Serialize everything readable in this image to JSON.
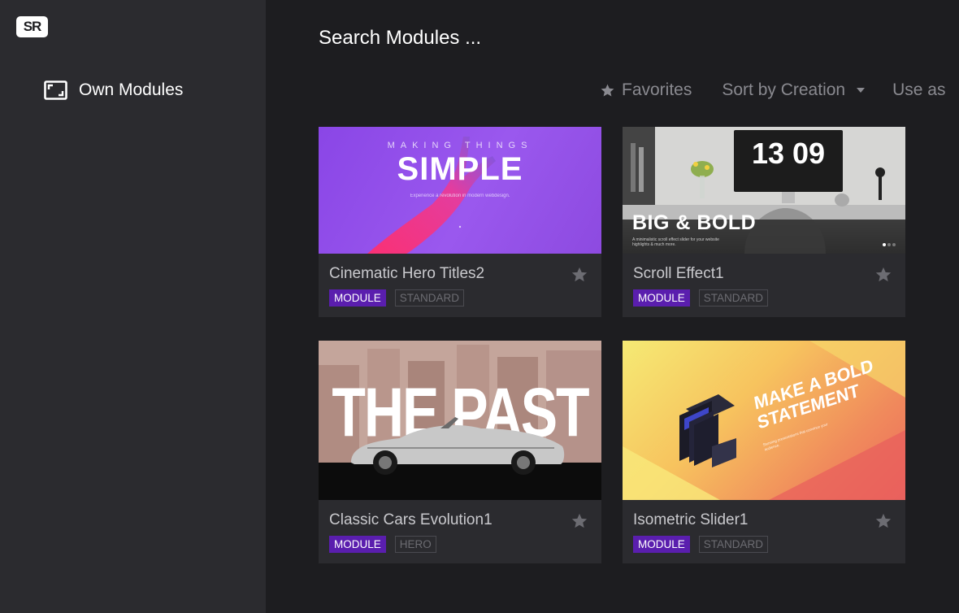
{
  "app": {
    "logo": "SR"
  },
  "sidebar": {
    "items": [
      {
        "label": "Own Modules",
        "icon": "modules-icon"
      }
    ]
  },
  "search": {
    "placeholder": "Search Modules ..."
  },
  "toolbar": {
    "favorites_label": "Favorites",
    "sort_label": "Sort by Creation",
    "use_label": "Use as"
  },
  "colors": {
    "sidebar_bg": "#2b2b2f",
    "main_bg": "#1d1d20",
    "card_bg": "#2b2b2f",
    "module_tag": "#5a1eae",
    "muted_text": "#8a8a90"
  },
  "modules": [
    {
      "title": "Cinematic Hero Titles2",
      "tags": [
        "MODULE",
        "STANDARD"
      ],
      "thumb": {
        "kicker": "MAKING THINGS",
        "headline": "SIMPLE",
        "subtext": "Experience a revolution in modern webdesign."
      }
    },
    {
      "title": "Scroll Effect1",
      "tags": [
        "MODULE",
        "STANDARD"
      ],
      "thumb": {
        "clock": "13 09",
        "headline": "BIG & BOLD",
        "subtext": "A minimalistic scroll effect slider for your website highlights & much more."
      }
    },
    {
      "title": "Classic Cars Evolution1",
      "tags": [
        "MODULE",
        "HERO"
      ],
      "thumb": {
        "headline": "THE PAST"
      }
    },
    {
      "title": "Isometric Slider1",
      "tags": [
        "MODULE",
        "STANDARD"
      ],
      "thumb": {
        "headline_line1": "MAKE A BOLD",
        "headline_line2": "STATEMENT",
        "subtext": "Stunning presentations that convince your audience."
      }
    }
  ]
}
